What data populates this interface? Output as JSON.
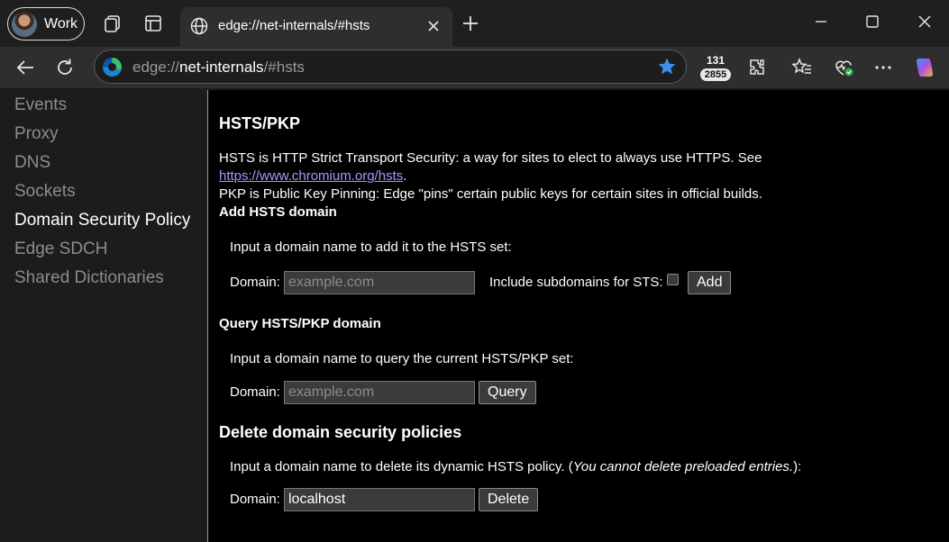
{
  "profile": {
    "label": "Work"
  },
  "tab": {
    "title": "edge://net-internals/#hsts"
  },
  "omnibox": {
    "scheme": "edge://",
    "host": "net-internals",
    "path": "/#hsts"
  },
  "toolbar": {
    "counter_top": "131",
    "counter_bottom": "2855"
  },
  "sidebar": {
    "items": [
      {
        "label": "Events"
      },
      {
        "label": "Proxy"
      },
      {
        "label": "DNS"
      },
      {
        "label": "Sockets"
      },
      {
        "label": "Domain Security Policy"
      },
      {
        "label": "Edge SDCH"
      },
      {
        "label": "Shared Dictionaries"
      }
    ],
    "active_index": 4
  },
  "content": {
    "title": "HSTS/PKP",
    "intro_line1": "HSTS is HTTP Strict Transport Security: a way for sites to elect to always use HTTPS. See ",
    "intro_link": "https://www.chromium.org/hsts",
    "intro_line1_end": ".",
    "intro_line2": "PKP is Public Key Pinning: Edge \"pins\" certain public keys for certain sites in official builds.",
    "add": {
      "heading": "Add HSTS domain",
      "instruction": "Input a domain name to add it to the HSTS set:",
      "domain_label": "Domain:",
      "domain_placeholder": "example.com",
      "subdomains_label": "Include subdomains for STS:",
      "button": "Add"
    },
    "query": {
      "heading": "Query HSTS/PKP domain",
      "instruction": "Input a domain name to query the current HSTS/PKP set:",
      "domain_label": "Domain:",
      "domain_placeholder": "example.com",
      "button": "Query"
    },
    "delete": {
      "heading": "Delete domain security policies",
      "instruction_main": "Input a domain name to delete its dynamic HSTS policy. (",
      "instruction_italic": "You cannot delete preloaded entries.",
      "instruction_end": "):",
      "domain_label": "Domain:",
      "domain_value": "localhost",
      "button": "Delete"
    }
  },
  "colors": {
    "link": "#9c9cff",
    "accent_star": "#3b8eea"
  }
}
